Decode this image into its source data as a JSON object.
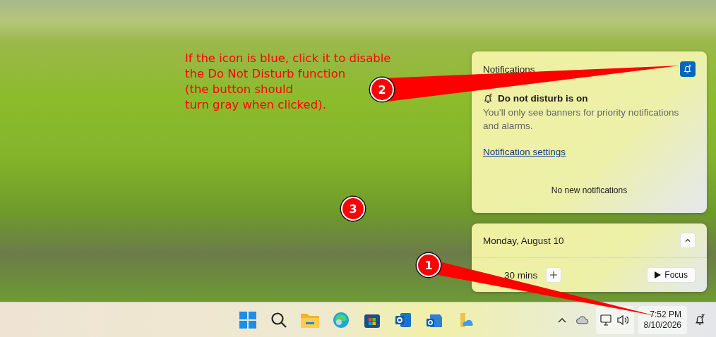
{
  "annotation": {
    "lines": [
      "If the icon is blue, click it to disable",
      "the Do Not Disturb function",
      "(the button should",
      "turn gray when clicked)."
    ]
  },
  "callouts": [
    {
      "label": "1"
    },
    {
      "label": "2"
    },
    {
      "label": "3"
    }
  ],
  "notifications": {
    "title": "Notifications",
    "dnd_on": true,
    "dnd_title": "Do not disturb is on",
    "dnd_text": "You’ll only see banners for priority notifications and alarms.",
    "settings_link": "Notification settings",
    "empty_text": "No new notifications"
  },
  "calendar": {
    "date": "Monday, August 10",
    "expanded": true,
    "duration": "30 mins",
    "focus_button": "Focus"
  },
  "taskbar": {
    "time": "7:52 PM",
    "date": "8/10/2026"
  }
}
